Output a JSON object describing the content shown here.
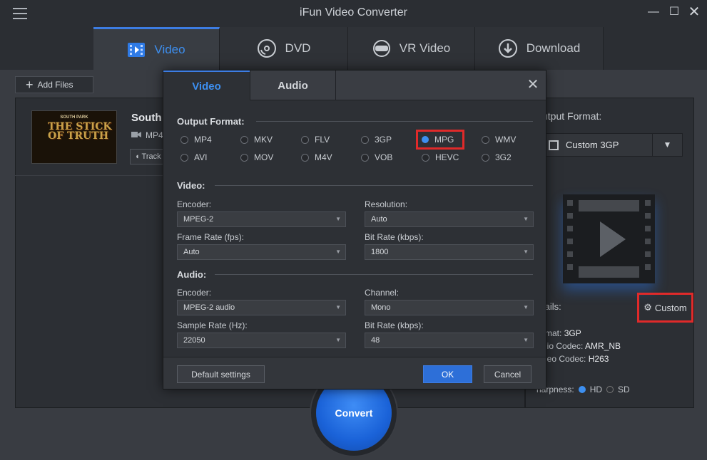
{
  "app": {
    "title": "iFun Video Converter"
  },
  "window": {
    "minimize": "—",
    "maximize": "☐",
    "close": "✕"
  },
  "tabs": [
    {
      "label": "Video",
      "icon": "video-icon",
      "active": true
    },
    {
      "label": "DVD",
      "icon": "dvd-icon",
      "active": false
    },
    {
      "label": "VR Video",
      "icon": "vr-icon",
      "active": false
    },
    {
      "label": "Download",
      "icon": "download-icon",
      "active": false
    }
  ],
  "toolbar": {
    "add_files": "Add Files"
  },
  "file": {
    "title": "South",
    "format": "MP4",
    "track": "Track",
    "thumb_top": "SOUTH PARK",
    "thumb_title": "THE STICK OF TRUTH"
  },
  "right": {
    "output_format_label": "utput Format:",
    "output_format_value": "Custom 3GP",
    "details_label": "tails:",
    "custom_label": "Custom",
    "format_label": "rmat:",
    "format_value": "3GP",
    "audio_codec_label": "dio Codec:",
    "audio_codec_value": "AMR_NB",
    "video_codec_label": "deo Codec:",
    "video_codec_value": "H263",
    "sharpness_label": "harpness:",
    "sharpness_hd": "HD",
    "sharpness_sd": "SD"
  },
  "convert": {
    "label": "Convert"
  },
  "dialog": {
    "tab_video": "Video",
    "tab_audio": "Audio",
    "close": "✕",
    "output_format_label": "Output Format:",
    "formats_row1": [
      "MP4",
      "MKV",
      "FLV",
      "3GP",
      "MPG",
      "WMV"
    ],
    "formats_row2": [
      "AVI",
      "MOV",
      "M4V",
      "VOB",
      "HEVC",
      "3G2"
    ],
    "selected_format": "MPG",
    "video_section": "Video:",
    "video_encoder_label": "Encoder:",
    "video_encoder": "MPEG-2",
    "resolution_label": "Resolution:",
    "resolution": "Auto",
    "frame_rate_label": "Frame Rate (fps):",
    "frame_rate": "Auto",
    "video_bitrate_label": "Bit Rate (kbps):",
    "video_bitrate": "1800",
    "audio_section": "Audio:",
    "audio_encoder_label": "Encoder:",
    "audio_encoder": "MPEG-2 audio",
    "channel_label": "Channel:",
    "channel": "Mono",
    "sample_rate_label": "Sample Rate (Hz):",
    "sample_rate": "22050",
    "audio_bitrate_label": "Bit Rate (kbps):",
    "audio_bitrate": "48",
    "default_settings": "Default settings",
    "ok": "OK",
    "cancel": "Cancel"
  },
  "colors": {
    "accent": "#3d8ff0",
    "highlight": "#e02a2a",
    "background": "#2b2e33"
  }
}
